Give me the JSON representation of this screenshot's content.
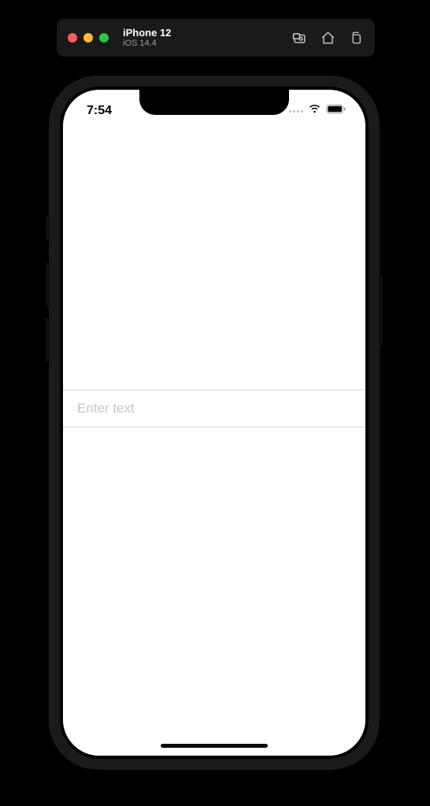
{
  "simulator": {
    "device": "iPhone 12",
    "os": "iOS 14.4"
  },
  "statusbar": {
    "time": "7:54"
  },
  "input": {
    "placeholder": "Enter text",
    "value": ""
  }
}
